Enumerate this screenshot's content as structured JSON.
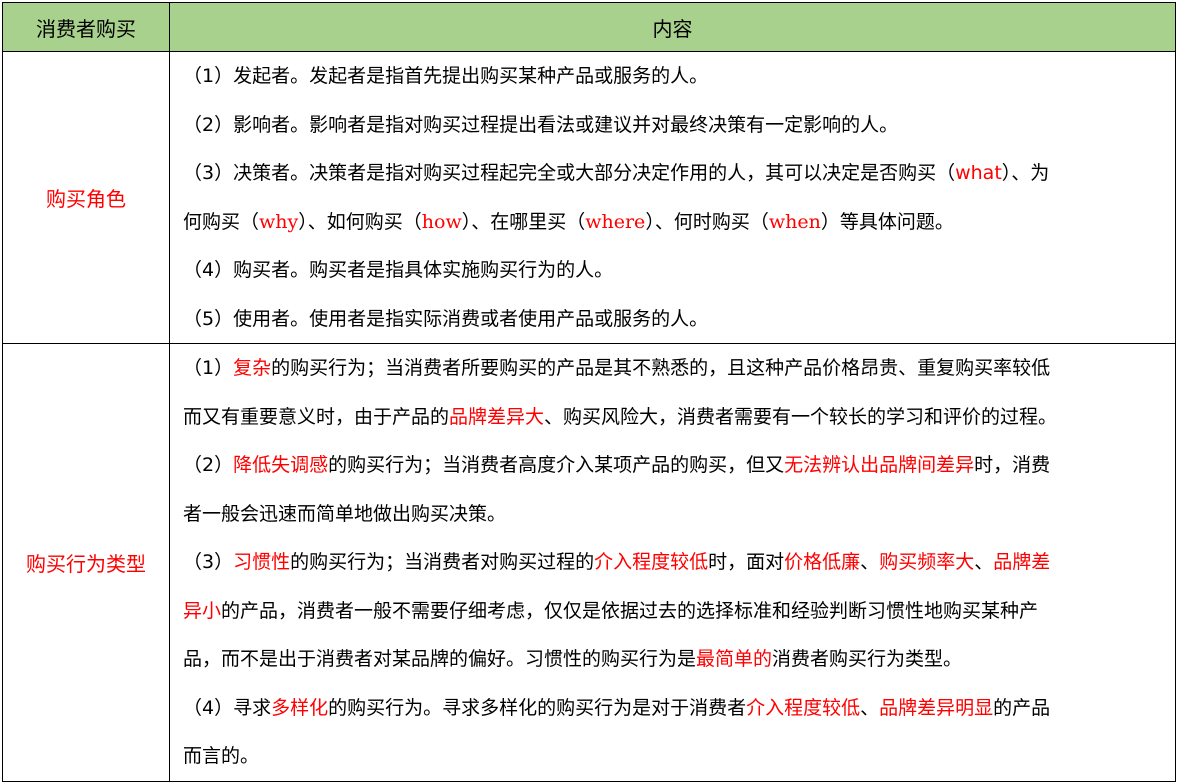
{
  "header": {
    "col1": "消费者购买",
    "col2": "内容"
  },
  "rows": [
    {
      "label": "购买角色",
      "lines": [
        [
          {
            "t": "（1）发起者。发起者是指首先提出购买某种产品或服务的人。"
          }
        ],
        [
          {
            "t": "（2）影响者。影响者是指对购买过程提出看法或建议并对最终决策有一定影响的人。"
          }
        ],
        [
          {
            "t": "（3）决策者。决策者是指对购买过程起完全或大部分决定作用的人，其可以决定是否购买（"
          },
          {
            "t": "what",
            "r": true
          },
          {
            "t": "）、为"
          }
        ],
        [
          {
            "t": "何购买（"
          },
          {
            "t": "why",
            "r": true,
            "s": true
          },
          {
            "t": "）、如何购买（"
          },
          {
            "t": "how",
            "r": true,
            "s": true
          },
          {
            "t": "）、在哪里买（"
          },
          {
            "t": "where",
            "r": true,
            "s": true
          },
          {
            "t": "）、何时购买（"
          },
          {
            "t": "when",
            "r": true,
            "s": true
          },
          {
            "t": "）等具体问题。"
          }
        ],
        [
          {
            "t": "（4）购买者。购买者是指具体实施购买行为的人。"
          }
        ],
        [
          {
            "t": "（5）使用者。使用者是指实际消费或者使用产品或服务的人。"
          }
        ]
      ]
    },
    {
      "label": "购买行为类型",
      "lines": [
        [
          {
            "t": "（1）"
          },
          {
            "t": "复杂",
            "r": true
          },
          {
            "t": "的购买行为；当消费者所要购买的产品是其不熟悉的，且这种产品价格昂贵、重复购买率较低"
          }
        ],
        [
          {
            "t": "而又有重要意义时，由于产品的"
          },
          {
            "t": "品牌差异大",
            "r": true
          },
          {
            "t": "、购买风险大，消费者需要有一个较长的学习和评价的过程。"
          }
        ],
        [
          {
            "t": "（2）"
          },
          {
            "t": "降低失调感",
            "r": true
          },
          {
            "t": "的购买行为；当消费者高度介入某项产品的购买，但又"
          },
          {
            "t": "无法辨认出品牌间差异",
            "r": true
          },
          {
            "t": "时，消费"
          }
        ],
        [
          {
            "t": "者一般会迅速而简单地做出购买决策。"
          }
        ],
        [
          {
            "t": "（3）"
          },
          {
            "t": "习惯性",
            "r": true
          },
          {
            "t": "的购买行为；当消费者对购买过程的"
          },
          {
            "t": "介入程度较低",
            "r": true
          },
          {
            "t": "时，面对"
          },
          {
            "t": "价格低廉",
            "r": true
          },
          {
            "t": "、"
          },
          {
            "t": "购买频率大",
            "r": true
          },
          {
            "t": "、"
          },
          {
            "t": "品牌差",
            "r": true
          }
        ],
        [
          {
            "t": "异小",
            "r": true
          },
          {
            "t": "的产品，消费者一般不需要仔细考虑，仅仅是依据过去的选择标准和经验判断习惯性地购买某种产"
          }
        ],
        [
          {
            "t": "品，而不是出于消费者对某品牌的偏好。习惯性的购买行为是"
          },
          {
            "t": "最简单的",
            "r": true
          },
          {
            "t": "消费者购买行为类型。"
          }
        ],
        [
          {
            "t": "（4）寻求"
          },
          {
            "t": "多样化",
            "r": true
          },
          {
            "t": "的购买行为。寻求多样化的购买行为是对于消费者"
          },
          {
            "t": "介入程度较低",
            "r": true
          },
          {
            "t": "、"
          },
          {
            "t": "品牌差异明显",
            "r": true
          },
          {
            "t": "的产品"
          }
        ],
        [
          {
            "t": "而言的。"
          }
        ]
      ]
    }
  ]
}
